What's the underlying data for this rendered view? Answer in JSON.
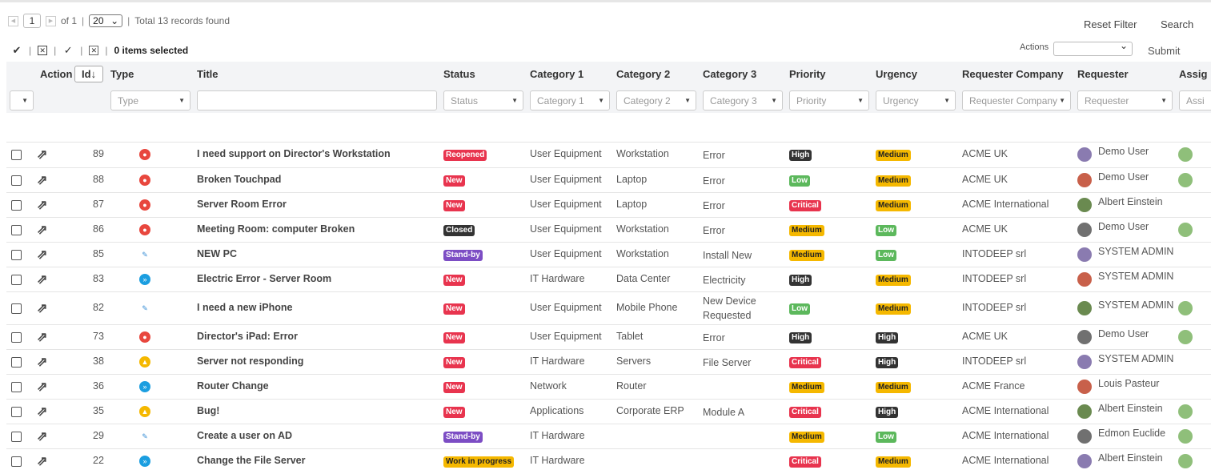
{
  "pagination": {
    "page": "1",
    "of_label": "of 1",
    "page_size": "20",
    "total": "Total 13 records found"
  },
  "selection": {
    "label": "0 items selected"
  },
  "links": {
    "reset_filter": "Reset Filter",
    "search": "Search",
    "actions_label": "Actions",
    "submit": "Submit"
  },
  "columns": {
    "action": "Action",
    "id": "Id",
    "type": "Type",
    "title": "Title",
    "status": "Status",
    "cat1": "Category 1",
    "cat2": "Category 2",
    "cat3": "Category 3",
    "priority": "Priority",
    "urgency": "Urgency",
    "company": "Requester Company",
    "requester": "Requester",
    "assignee": "Assig"
  },
  "filters": {
    "type": "Type",
    "status": "Status",
    "cat1": "Category 1",
    "cat2": "Category 2",
    "cat3": "Category 3",
    "priority": "Priority",
    "urgency": "Urgency",
    "company": "Requester Company",
    "requester": "Requester",
    "assignee": "Assi"
  },
  "colors": {
    "Reopened": "#e8344e",
    "New": "#e8344e",
    "Closed": "#333333",
    "Stand-by": "#7c4dc4",
    "Work in progress": "#f5b800",
    "High": "#333333",
    "Low": "#5cb85c",
    "Critical": "#e8344e",
    "Medium": "#f5b800",
    "incident": "#e8473e",
    "request": "#3a8fd6",
    "change": "#1b9ee0",
    "problem": "#f5b800"
  },
  "rows": [
    {
      "id": "89",
      "type": "incident",
      "title": "I need support on Director's Workstation",
      "status": "Reopened",
      "cat1": "User Equipment",
      "cat2": "Workstation",
      "cat3": "Error",
      "priority": "High",
      "urgency": "Medium",
      "company": "ACME UK",
      "requester": "Demo User",
      "assignee_avatar": true
    },
    {
      "id": "88",
      "type": "incident",
      "title": "Broken Touchpad",
      "status": "New",
      "cat1": "User Equipment",
      "cat2": "Laptop",
      "cat3": "Error",
      "priority": "Low",
      "urgency": "Medium",
      "company": "ACME UK",
      "requester": "Demo User",
      "assignee_avatar": true
    },
    {
      "id": "87",
      "type": "incident",
      "title": "Server Room Error",
      "status": "New",
      "cat1": "User Equipment",
      "cat2": "Laptop",
      "cat3": "Error",
      "priority": "Critical",
      "urgency": "Medium",
      "company": "ACME International",
      "requester": "Albert Einstein",
      "assignee_avatar": false
    },
    {
      "id": "86",
      "type": "incident",
      "title": "Meeting Room: computer Broken",
      "status": "Closed",
      "cat1": "User Equipment",
      "cat2": "Workstation",
      "cat3": "Error",
      "priority": "Medium",
      "urgency": "Low",
      "company": "ACME UK",
      "requester": "Demo User",
      "assignee_avatar": true
    },
    {
      "id": "85",
      "type": "request",
      "title": "NEW PC",
      "status": "Stand-by",
      "cat1": "User Equipment",
      "cat2": "Workstation",
      "cat3": "Install New",
      "priority": "Medium",
      "urgency": "Low",
      "company": "INTODEEP srl",
      "requester": "SYSTEM ADMIN",
      "assignee_avatar": false
    },
    {
      "id": "83",
      "type": "change",
      "title": "Electric Error - Server Room",
      "status": "New",
      "cat1": "IT Hardware",
      "cat2": "Data Center",
      "cat3": "Electricity",
      "priority": "High",
      "urgency": "Medium",
      "company": "INTODEEP srl",
      "requester": "SYSTEM ADMIN",
      "assignee_avatar": false
    },
    {
      "id": "82",
      "type": "request",
      "title": "I need a new iPhone",
      "status": "New",
      "cat1": "User Equipment",
      "cat2": "Mobile Phone",
      "cat3": "New Device Requested",
      "priority": "Low",
      "urgency": "Medium",
      "company": "INTODEEP srl",
      "requester": "SYSTEM ADMIN",
      "assignee_avatar": true
    },
    {
      "id": "73",
      "type": "incident",
      "title": "Director's iPad: Error",
      "status": "New",
      "cat1": "User Equipment",
      "cat2": "Tablet",
      "cat3": "Error",
      "priority": "High",
      "urgency": "High",
      "company": "ACME UK",
      "requester": "Demo User",
      "assignee_avatar": true
    },
    {
      "id": "38",
      "type": "problem",
      "title": "Server not responding",
      "status": "New",
      "cat1": "IT Hardware",
      "cat2": "Servers",
      "cat3": "File Server",
      "priority": "Critical",
      "urgency": "High",
      "company": "INTODEEP srl",
      "requester": "SYSTEM ADMIN",
      "assignee_avatar": false
    },
    {
      "id": "36",
      "type": "change",
      "title": "Router Change",
      "status": "New",
      "cat1": "Network",
      "cat2": "Router",
      "cat3": "",
      "priority": "Medium",
      "urgency": "Medium",
      "company": "ACME France",
      "requester": "Louis Pasteur",
      "assignee_avatar": false
    },
    {
      "id": "35",
      "type": "problem",
      "title": "Bug!",
      "status": "New",
      "cat1": "Applications",
      "cat2": "Corporate ERP",
      "cat3": "Module A",
      "priority": "Critical",
      "urgency": "High",
      "company": "ACME International",
      "requester": "Albert Einstein",
      "assignee_avatar": true
    },
    {
      "id": "29",
      "type": "request",
      "title": "Create a user on AD",
      "status": "Stand-by",
      "cat1": "IT Hardware",
      "cat2": "",
      "cat3": "",
      "priority": "Medium",
      "urgency": "Low",
      "company": "ACME International",
      "requester": "Edmon Euclide",
      "assignee_avatar": true
    },
    {
      "id": "22",
      "type": "change",
      "title": "Change the File Server",
      "status": "Work in progress",
      "cat1": "IT Hardware",
      "cat2": "",
      "cat3": "",
      "priority": "Critical",
      "urgency": "Medium",
      "company": "ACME International",
      "requester": "Albert Einstein",
      "assignee_avatar": true
    }
  ]
}
